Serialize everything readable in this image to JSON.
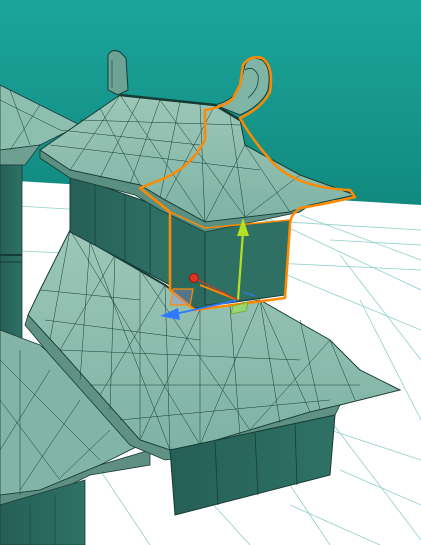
{
  "viewport": {
    "sky_color_top": "#1a9e95",
    "sky_color_bottom": "#12877e",
    "floor_color": "#ffffff",
    "grid_line_color": "#8fd0c9",
    "mesh_face_color": "#7fb5a8",
    "mesh_face_light": "#a9d2c4",
    "mesh_face_dark": "#2f6b60",
    "wall_color": "#2c6d62",
    "wire_color": "#173c35",
    "selection_outline_color": "#ff8a00"
  },
  "selection": {
    "object": "pagoda-top-tier",
    "outline": "orange"
  },
  "gizmo": {
    "type": "move",
    "y_axis_color": "#b4e021",
    "x_axis_color": "#ff8a00",
    "z_axis_color": "#2f78ff",
    "center_color": "#e0331f",
    "plane_handle_color": "#a38bd8"
  }
}
